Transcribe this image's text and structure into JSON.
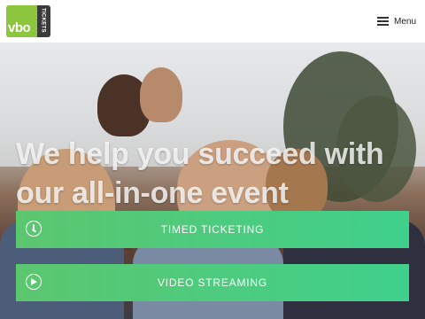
{
  "header": {
    "logo": {
      "main_text": "vbo",
      "tab_text": "TICKETS"
    },
    "menu_label": "Menu"
  },
  "hero": {
    "headline": "We help you succeed with our all-in-one event ticketing software.",
    "buttons": [
      {
        "label": "TIMED TICKETING",
        "icon": "clock-icon"
      },
      {
        "label": "VIDEO STREAMING",
        "icon": "play-icon"
      }
    ]
  },
  "colors": {
    "brand_green": "#8cc63f",
    "button_gradient_start": "#5cc66f",
    "button_gradient_end": "#3fd08c",
    "logo_dark": "#3a3a3a"
  }
}
